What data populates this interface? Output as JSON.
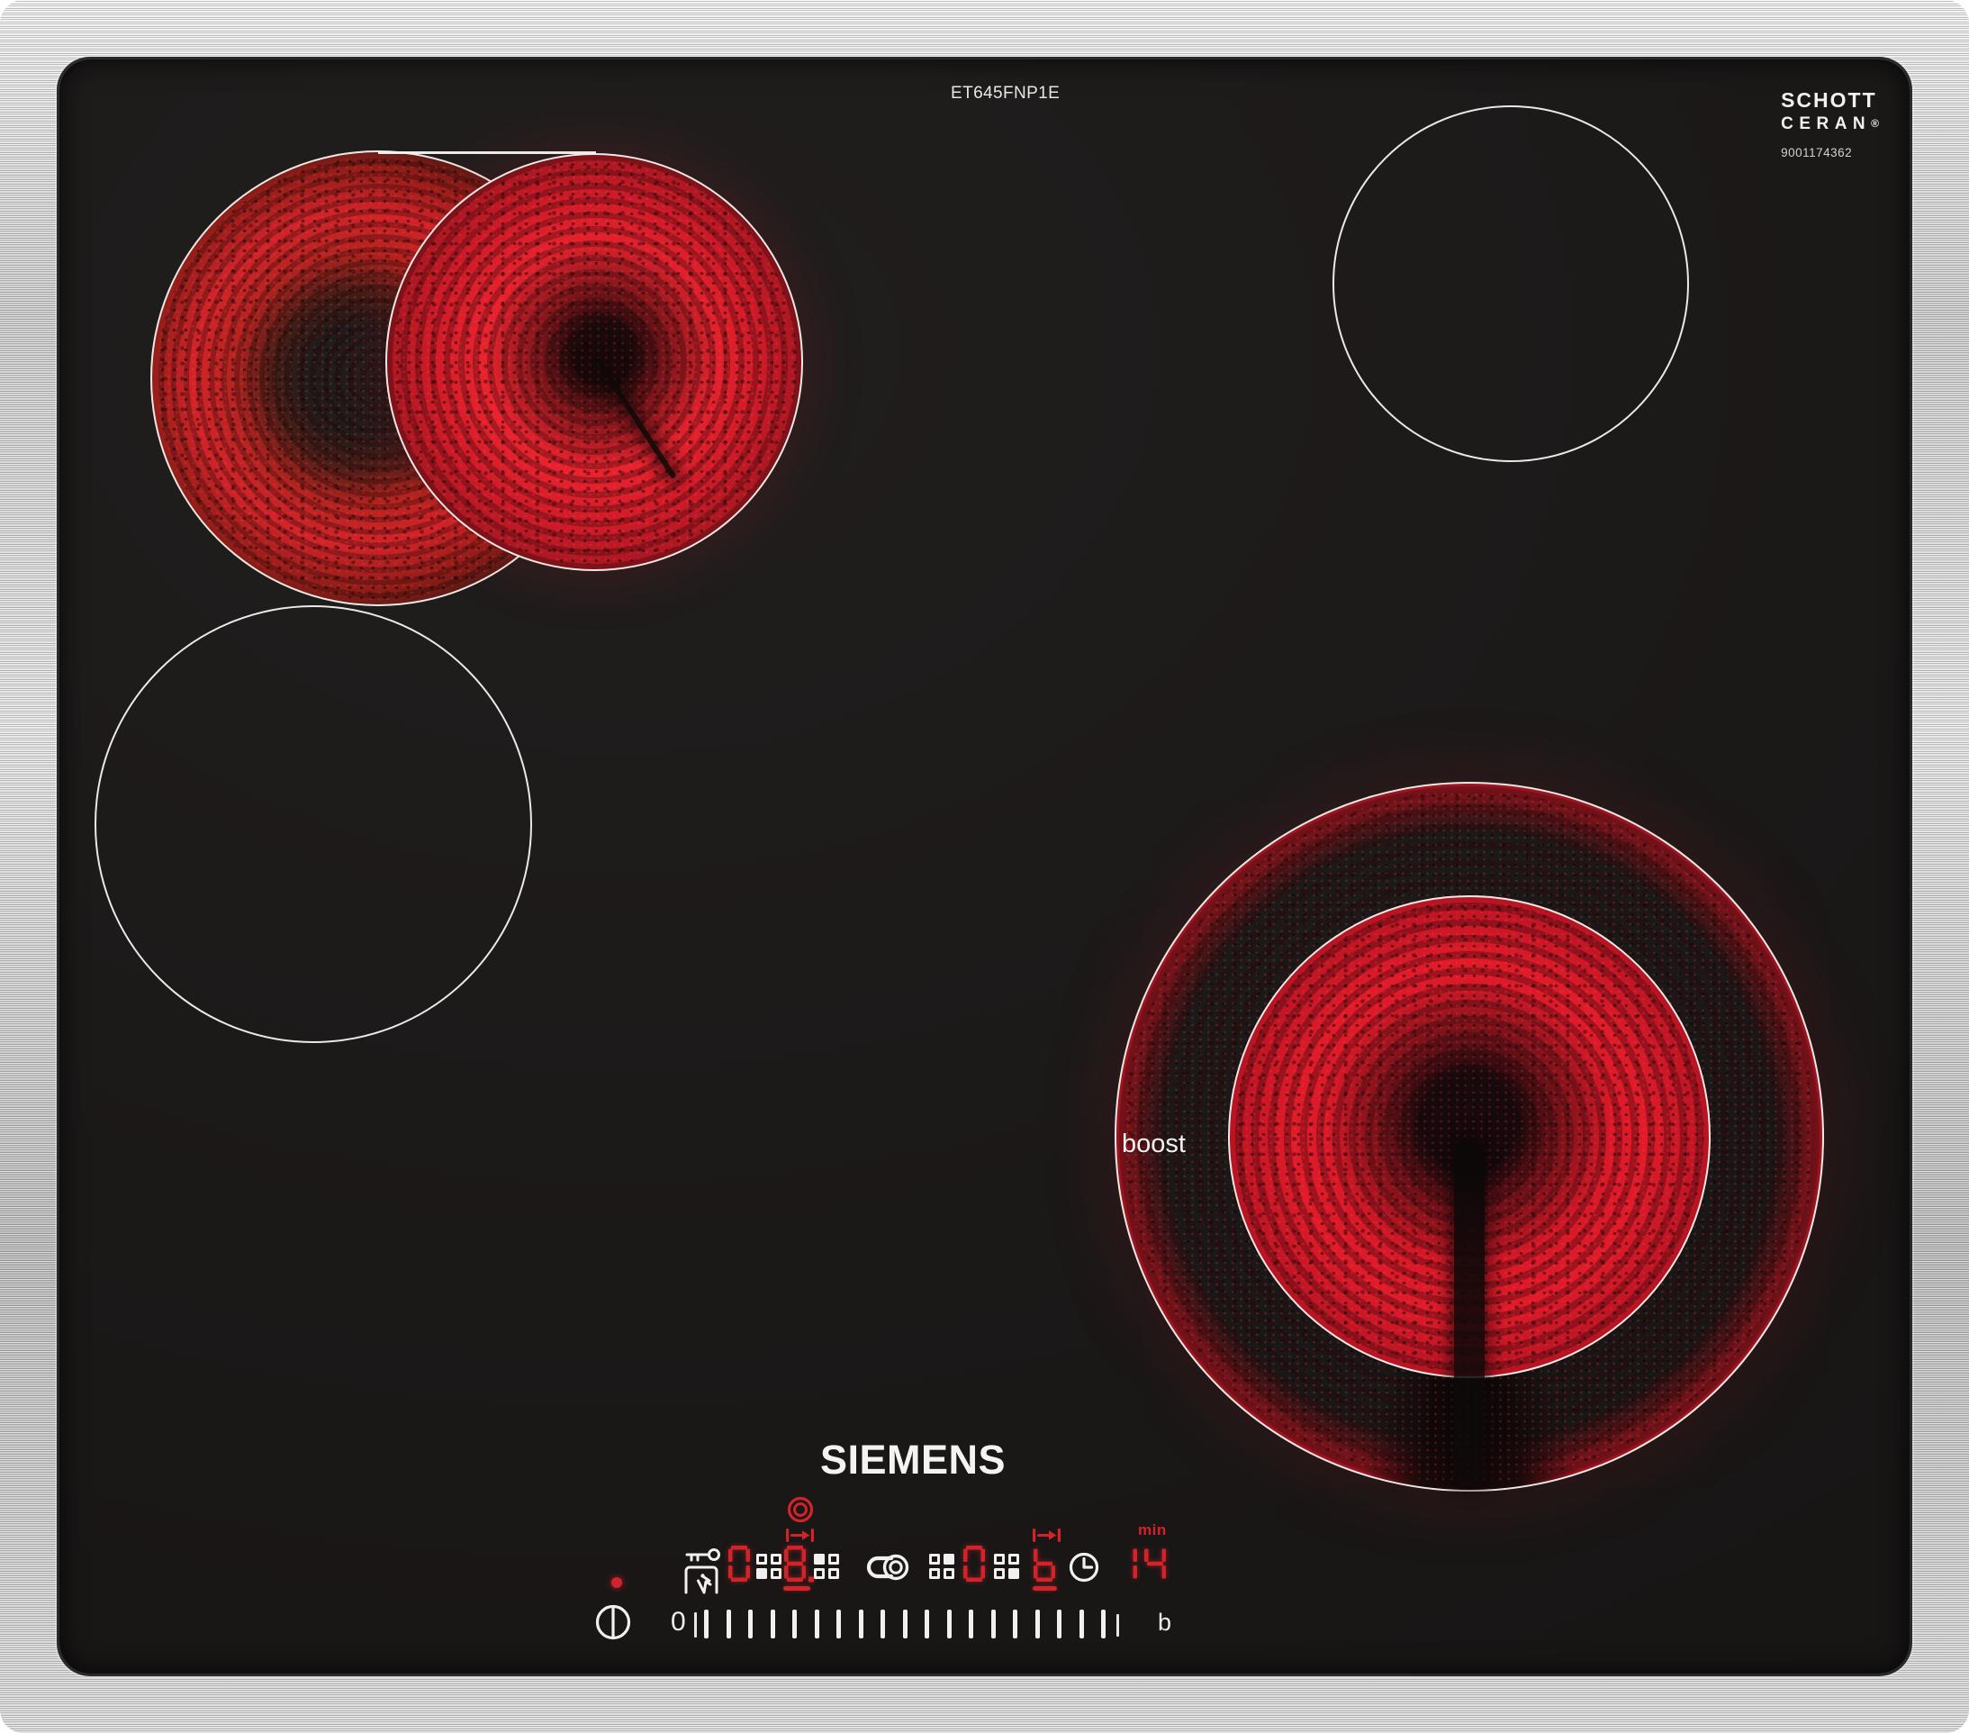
{
  "branding": {
    "model": "ET645FNP1E",
    "logo": "SIEMENS",
    "glass_brand": {
      "line1": "SCHOTT",
      "line2": "CERAN",
      "registered": "®",
      "code": "9001174362"
    }
  },
  "zones": {
    "rear_left": {
      "name": "dual-circuit oval zone",
      "state": "heating"
    },
    "rear_right": {
      "name": "single zone",
      "state": "off"
    },
    "front_left": {
      "name": "single zone",
      "state": "off"
    },
    "front_right": {
      "name": "triple-circuit zone",
      "state": "heating",
      "label": "boost"
    }
  },
  "control_panel": {
    "left_level": "0",
    "selected_zone_level": "8.",
    "right_level": "0",
    "booster_indicator": "b",
    "timer": {
      "value": "14",
      "unit": "min"
    },
    "zone_selectors": [
      "bl",
      "tl",
      "tr",
      "br"
    ],
    "slider": {
      "start_label": "0",
      "end_label": "b",
      "tick_count": 19
    }
  },
  "icons": [
    "key-lock-icon",
    "zone-extend-arrow-icon",
    "dial-icon",
    "pot-detection-icon",
    "clock-icon",
    "power-icon",
    "residual-heat-dot"
  ],
  "colors": {
    "display_red": "#d2232a",
    "icon_white": "#f2f0ee",
    "glass_black": "#1c1919",
    "glow_red": "#e01b2a",
    "metal": "#cfcfcf"
  }
}
